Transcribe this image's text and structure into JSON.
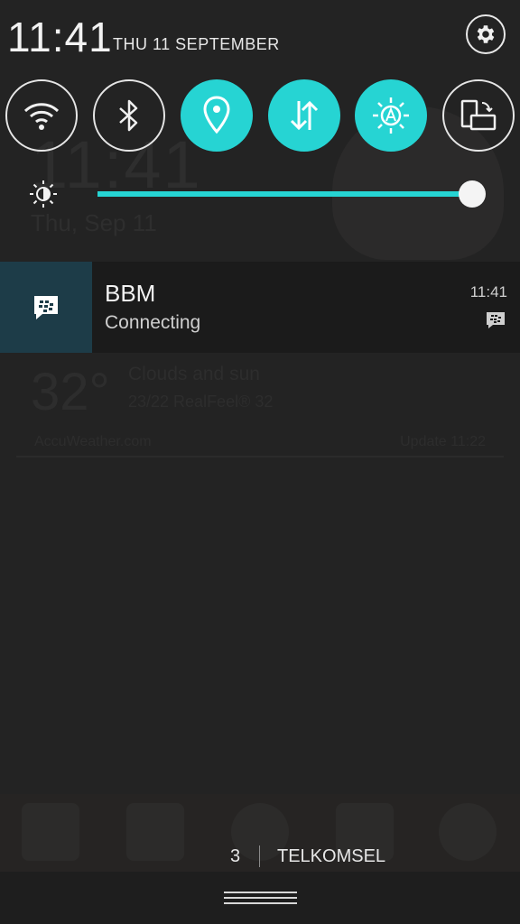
{
  "colors": {
    "accent": "#26d4d3",
    "notification_icon_bg": "#1d3c48"
  },
  "header": {
    "time": "11:41",
    "date": "THU 11 SEPTEMBER",
    "settings_icon": "gear-icon"
  },
  "quick_toggles": [
    {
      "name": "wifi",
      "icon": "wifi-icon",
      "state": "off"
    },
    {
      "name": "bluetooth",
      "icon": "bluetooth-icon",
      "state": "off"
    },
    {
      "name": "location",
      "icon": "location-pin-icon",
      "state": "on"
    },
    {
      "name": "data",
      "icon": "data-transfer-icon",
      "state": "on"
    },
    {
      "name": "auto-brightness",
      "icon": "auto-brightness-icon",
      "state": "on"
    },
    {
      "name": "auto-rotate",
      "icon": "rotate-icon",
      "state": "off"
    }
  ],
  "brightness": {
    "level_percent": 100,
    "icon": "brightness-icon"
  },
  "notification": {
    "app_icon": "bbm-icon",
    "title": "BBM",
    "text": "Connecting",
    "time": "11:41",
    "small_icon": "bbm-small-icon"
  },
  "background": {
    "clock": "11:41",
    "date": "Thu, Sep 11",
    "temperature": "32°",
    "condition": "Clouds and sun",
    "range": "23/22   RealFeel® 32",
    "brand": "AccuWeather.com",
    "update": "Update 11:22"
  },
  "carrier": {
    "count": "3",
    "name": "TELKOMSEL"
  },
  "handle": {
    "icon": "drag-handle-icon"
  }
}
